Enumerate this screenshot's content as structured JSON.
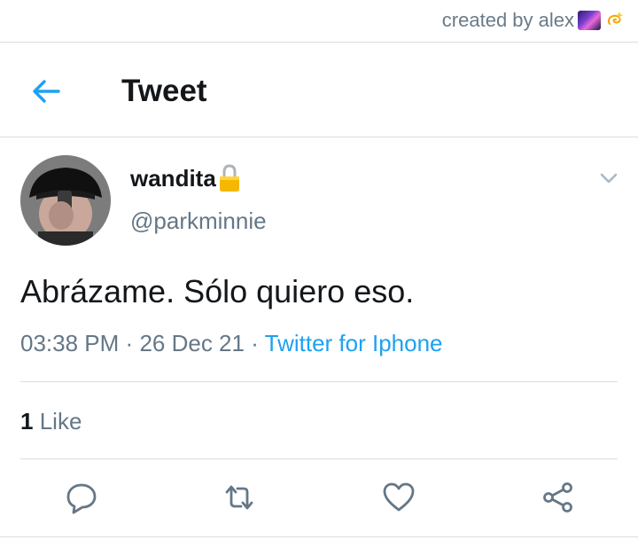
{
  "watermark": {
    "text": "created by alex",
    "emojis": [
      "galaxy-emoji",
      "dizzy-emoji"
    ]
  },
  "header": {
    "title": "Tweet",
    "back_icon": "arrow-left-icon"
  },
  "tweet": {
    "display_name": "wandita",
    "lock_icon": "lock-emoji",
    "handle": "@parkminnie",
    "text": "Abrázame. Sólo quiero eso.",
    "time": "03:38 PM",
    "date": "26 Dec 21",
    "separator": "·",
    "source": "Twitter for Iphone",
    "like_count": "1",
    "like_label": "Like"
  },
  "actions": [
    "reply-icon",
    "retweet-icon",
    "like-icon",
    "share-icon"
  ],
  "colors": {
    "accent": "#1da1f2",
    "text": "#14171a",
    "secondary": "#657786",
    "icon": "#657786",
    "divider": "#d9dde2"
  }
}
